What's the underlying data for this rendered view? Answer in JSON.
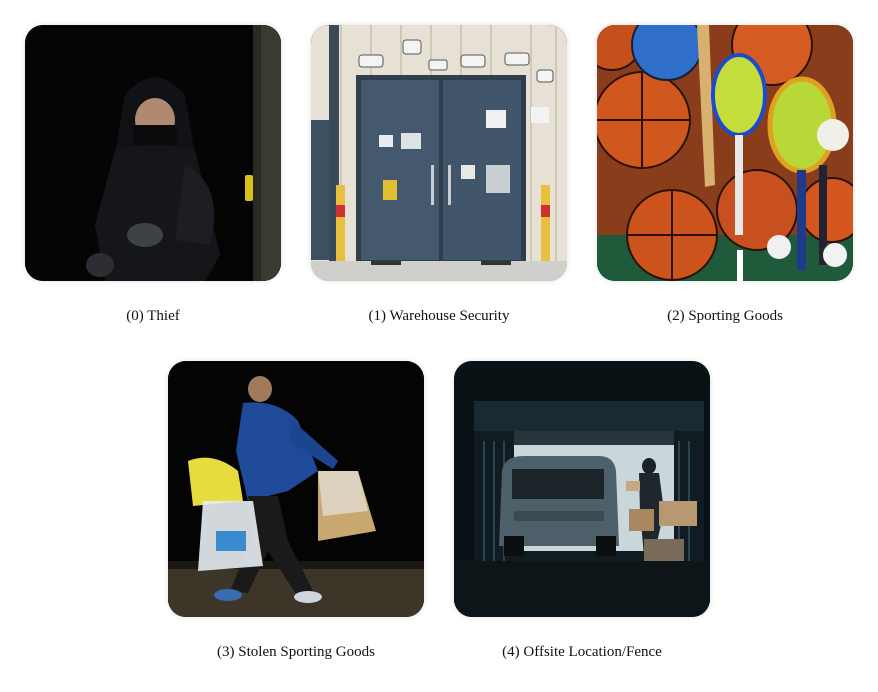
{
  "items": [
    {
      "caption": "(0) Thief",
      "icon": "thief-image"
    },
    {
      "caption": "(1) Warehouse Security",
      "icon": "warehouse-security-image"
    },
    {
      "caption": "(2) Sporting Goods",
      "icon": "sporting-goods-image"
    },
    {
      "caption": "(3) Stolen Sporting Goods",
      "icon": "stolen-goods-image"
    },
    {
      "caption": "(4) Offsite Location/Fence",
      "icon": "offsite-location-image"
    }
  ]
}
